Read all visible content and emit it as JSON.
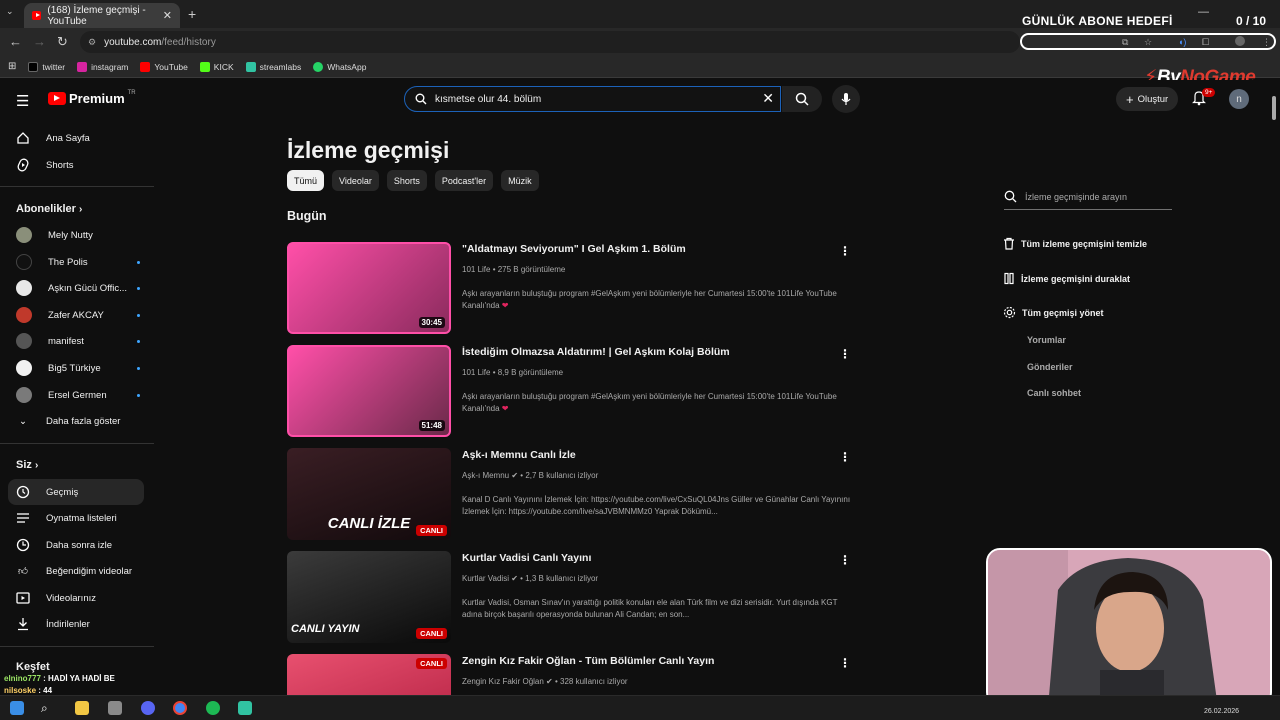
{
  "browser": {
    "tab_title": "(168) İzleme geçmişi - YouTube",
    "url_host": "youtube.com",
    "url_path": "/feed/history",
    "bookmarks": [
      {
        "label": "twitter",
        "icon": "x-icon",
        "color": "#000000"
      },
      {
        "label": "instagram",
        "icon": "instagram-icon",
        "color": "#d6249f"
      },
      {
        "label": "YouTube",
        "icon": "youtube-icon",
        "color": "#ff0000"
      },
      {
        "label": "KICK",
        "icon": "kick-icon",
        "color": "#53fc18"
      },
      {
        "label": "streamlabs",
        "icon": "streamlabs-icon",
        "color": "#31c3a2"
      },
      {
        "label": "WhatsApp",
        "icon": "whatsapp-icon",
        "color": "#25d366"
      }
    ]
  },
  "overlay": {
    "goal_title": "GÜNLÜK ABONE HEDEFİ",
    "goal_count": "0 / 10",
    "brand_prefix": "By",
    "brand_suffix": "NoGame"
  },
  "header": {
    "logo_text": "Premium",
    "logo_region": "TR",
    "search_value": "kısmetse olur 44. bölüm",
    "create_label": "Oluştur",
    "notif_badge": "9+",
    "avatar_initial": "n"
  },
  "sidebar": {
    "top": [
      {
        "label": "Ana Sayfa",
        "icon": "home-icon"
      },
      {
        "label": "Shorts",
        "icon": "shorts-icon"
      }
    ],
    "subscriptions_title": "Abonelikler",
    "subscriptions": [
      {
        "label": "Mely Nutty",
        "color": "#8a8f7a",
        "dot": false
      },
      {
        "label": "The Polis",
        "color": "#111111",
        "dot": true
      },
      {
        "label": "Aşkın Gücü Offic...",
        "color": "#e8e8e8",
        "dot": true
      },
      {
        "label": "Zafer AKCAY",
        "color": "#c0392b",
        "dot": true
      },
      {
        "label": "manifest",
        "color": "#555555",
        "dot": true
      },
      {
        "label": "Big5 Türkiye",
        "color": "#f1f1f1",
        "dot": true
      },
      {
        "label": "Ersel Germen",
        "color": "#7a7a7a",
        "dot": true
      }
    ],
    "show_more": "Daha fazla göster",
    "you_title": "Siz",
    "you_items": [
      {
        "label": "Geçmiş",
        "icon": "history-icon",
        "active": true
      },
      {
        "label": "Oynatma listeleri",
        "icon": "playlist-icon",
        "active": false
      },
      {
        "label": "Daha sonra izle",
        "icon": "clock-icon",
        "active": false
      },
      {
        "label": "Beğendiğim videolar",
        "icon": "like-icon",
        "active": false
      },
      {
        "label": "Videolarınız",
        "icon": "video-icon",
        "active": false
      },
      {
        "label": "İndirilenler",
        "icon": "download-icon",
        "active": false
      }
    ],
    "explore_title": "Keşfet"
  },
  "chat": [
    {
      "user": "elnino777",
      "message": "HADİ YA HADİ BE",
      "color": "#9be564"
    },
    {
      "user": "nilsoske",
      "message": "44",
      "color": "#ffd166"
    }
  ],
  "main": {
    "title": "İzleme geçmişi",
    "chips": [
      "Tümü",
      "Videolar",
      "Shorts",
      "Podcast'ler",
      "Müzik"
    ],
    "section": "Bugün",
    "videos": [
      {
        "title": "\"Aldatmayı Seviyorum\" I Gel Aşkım 1. Bölüm",
        "channel": "101 Life",
        "stats": "275 B görüntüleme",
        "desc": "Aşkı arayanların buluştuğu program #GelAşkım yeni bölümleriyle her Cumartesi 15:00'te 101Life YouTube Kanalı'nda",
        "duration": "30:45",
        "live": false,
        "verified": false,
        "thumb_text": "",
        "colors": [
          "#ff4fa8",
          "#8a2b5d"
        ]
      },
      {
        "title": "İstediğim Olmazsa Aldatırım! | Gel Aşkım Kolaj Bölüm",
        "channel": "101 Life",
        "stats": "8,9 B görüntüleme",
        "desc": "Aşkı arayanların buluştuğu program #GelAşkım yeni bölümleriyle her Cumartesi 15:00'te 101Life YouTube Kanalı'nda",
        "duration": "51:48",
        "live": false,
        "verified": false,
        "thumb_text": "",
        "colors": [
          "#ff4fa8",
          "#6b2a4a"
        ]
      },
      {
        "title": "Aşk-ı Memnu Canlı İzle",
        "channel": "Aşk-ı Memnu",
        "stats": "2,7 B kullanıcı izliyor",
        "desc": "Kanal D Canlı Yayınını İzlemek İçin: https://youtube.com/live/CxSuQL04Jns Güller ve Günahlar Canlı Yayınını İzlemek İçin: https://youtube.com/live/saJVBMNMMz0 Yaprak Dökümü...",
        "duration": "CANLI",
        "live": true,
        "verified": true,
        "thumb_text": "CANLI İZLE",
        "colors": [
          "#3a1e24",
          "#120a0c"
        ]
      },
      {
        "title": "Kurtlar Vadisi Canlı Yayını",
        "channel": "Kurtlar Vadisi",
        "stats": "1,3 B kullanıcı izliyor",
        "desc": "Kurtlar Vadisi, Osman Sınav'ın yarattığı politik konuları ele alan Türk film ve dizi serisidir. Yurt dışında KGT adına birçok başarılı operasyonda bulunan Ali Candan; en son...",
        "duration": "CANLI",
        "live": true,
        "verified": true,
        "thumb_text": "CANLI YAYIN",
        "colors": [
          "#2b2b2b",
          "#0a0a0a"
        ]
      },
      {
        "title": "Zengin Kız Fakir Oğlan - Tüm Bölümler Canlı Yayın",
        "channel": "Zengin Kız Fakir Oğlan",
        "stats": "328 kullanıcı izliyor",
        "desc": "",
        "duration": "CANLI",
        "live": true,
        "verified": true,
        "thumb_text": "",
        "colors": [
          "#e8506f",
          "#b01e3f"
        ]
      }
    ]
  },
  "right_panel": {
    "search_placeholder": "İzleme geçmişinde arayın",
    "clear": "Tüm izleme geçmişini temizle",
    "pause": "İzleme geçmişini duraklat",
    "manage": "Tüm geçmişi yönet",
    "sub_items": [
      "Yorumlar",
      "Gönderiler",
      "Canlı sohbet"
    ]
  },
  "taskbar": {
    "date": "26.02.2026"
  }
}
